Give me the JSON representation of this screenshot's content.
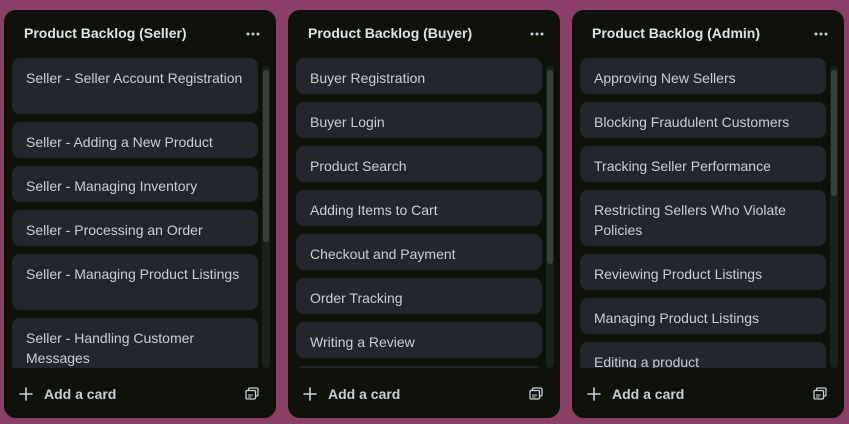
{
  "board": {
    "lists": [
      {
        "title": "Product Backlog (Seller)",
        "menu_icon": "more-horizontal-icon",
        "cards": [
          "Seller - Seller Account Registration",
          "Seller - Adding a New Product",
          "Seller - Managing Inventory",
          "Seller - Processing an Order",
          "Seller - Managing Product Listings",
          "Seller - Handling Customer Messages"
        ],
        "add_card_label": "Add a card",
        "add_icon": "plus-icon",
        "template_icon": "card-template-icon"
      },
      {
        "title": "Product Backlog (Buyer)",
        "menu_icon": "more-horizontal-icon",
        "cards": [
          "Buyer Registration",
          "Buyer Login",
          "Product Search",
          "Adding Items to Cart",
          "Checkout and Payment",
          "Order Tracking",
          "Writing a Review"
        ],
        "add_card_label": "Add a card",
        "add_icon": "plus-icon",
        "template_icon": "card-template-icon"
      },
      {
        "title": "Product Backlog (Admin)",
        "menu_icon": "more-horizontal-icon",
        "cards": [
          "Approving New Sellers",
          "Blocking Fraudulent Customers",
          "Tracking Seller Performance",
          "Restricting Sellers Who Violate Policies",
          "Reviewing Product Listings",
          "Managing Product Listings",
          "Editing a product"
        ],
        "add_card_label": "Add a card",
        "add_icon": "plus-icon",
        "template_icon": "card-template-icon"
      }
    ]
  },
  "colors": {
    "background": "#8c3f66",
    "list_background": "#0f120b",
    "card_background": "#22272b",
    "text": "#c7ced6",
    "title_text": "#dfe3e8"
  }
}
